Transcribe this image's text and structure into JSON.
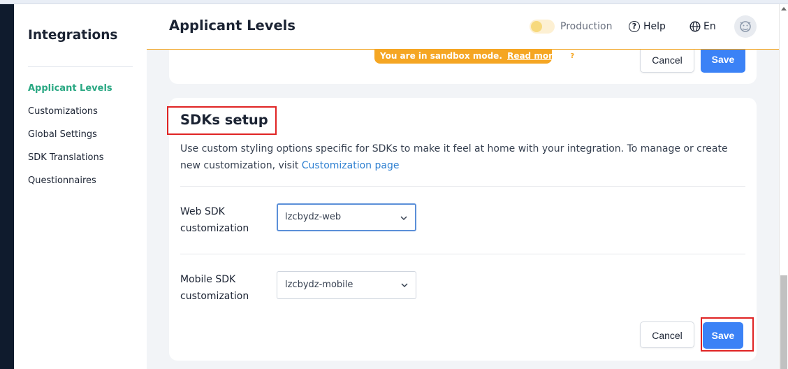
{
  "sidebar": {
    "title": "Integrations",
    "items": [
      {
        "label": "Applicant Levels"
      },
      {
        "label": "Customizations"
      },
      {
        "label": "Global Settings"
      },
      {
        "label": "SDK Translations"
      },
      {
        "label": "Questionnaires"
      }
    ]
  },
  "header": {
    "title": "Applicant Levels",
    "env_label": "Production",
    "help_label": "Help",
    "lang_label": "En",
    "icons": [
      "production-toggle",
      "help-icon",
      "globe-icon",
      "avatar"
    ]
  },
  "sandbox_banner": {
    "text": "You are in sandbox mode.",
    "link": "Read more",
    "icon": "question-icon"
  },
  "top_card": {
    "cancel_label": "Cancel",
    "save_label": "Save"
  },
  "sdk_card": {
    "title": "SDKs setup",
    "description": "Use custom styling options specific for SDKs to make it feel at home with your integration. To manage or create new customization, visit",
    "link": "Customization page",
    "web_label": "Web SDK customization",
    "web_value": "lzcbydz-web",
    "mobile_label": "Mobile SDK customization",
    "mobile_value": "lzcbydz-mobile",
    "cancel_label": "Cancel",
    "save_label": "Save"
  },
  "colors": {
    "accent": "#2aa883",
    "primary_button": "#3b82f6",
    "sandbox": "#f5a623",
    "highlight": "#e02424",
    "link": "#2f80d1"
  }
}
